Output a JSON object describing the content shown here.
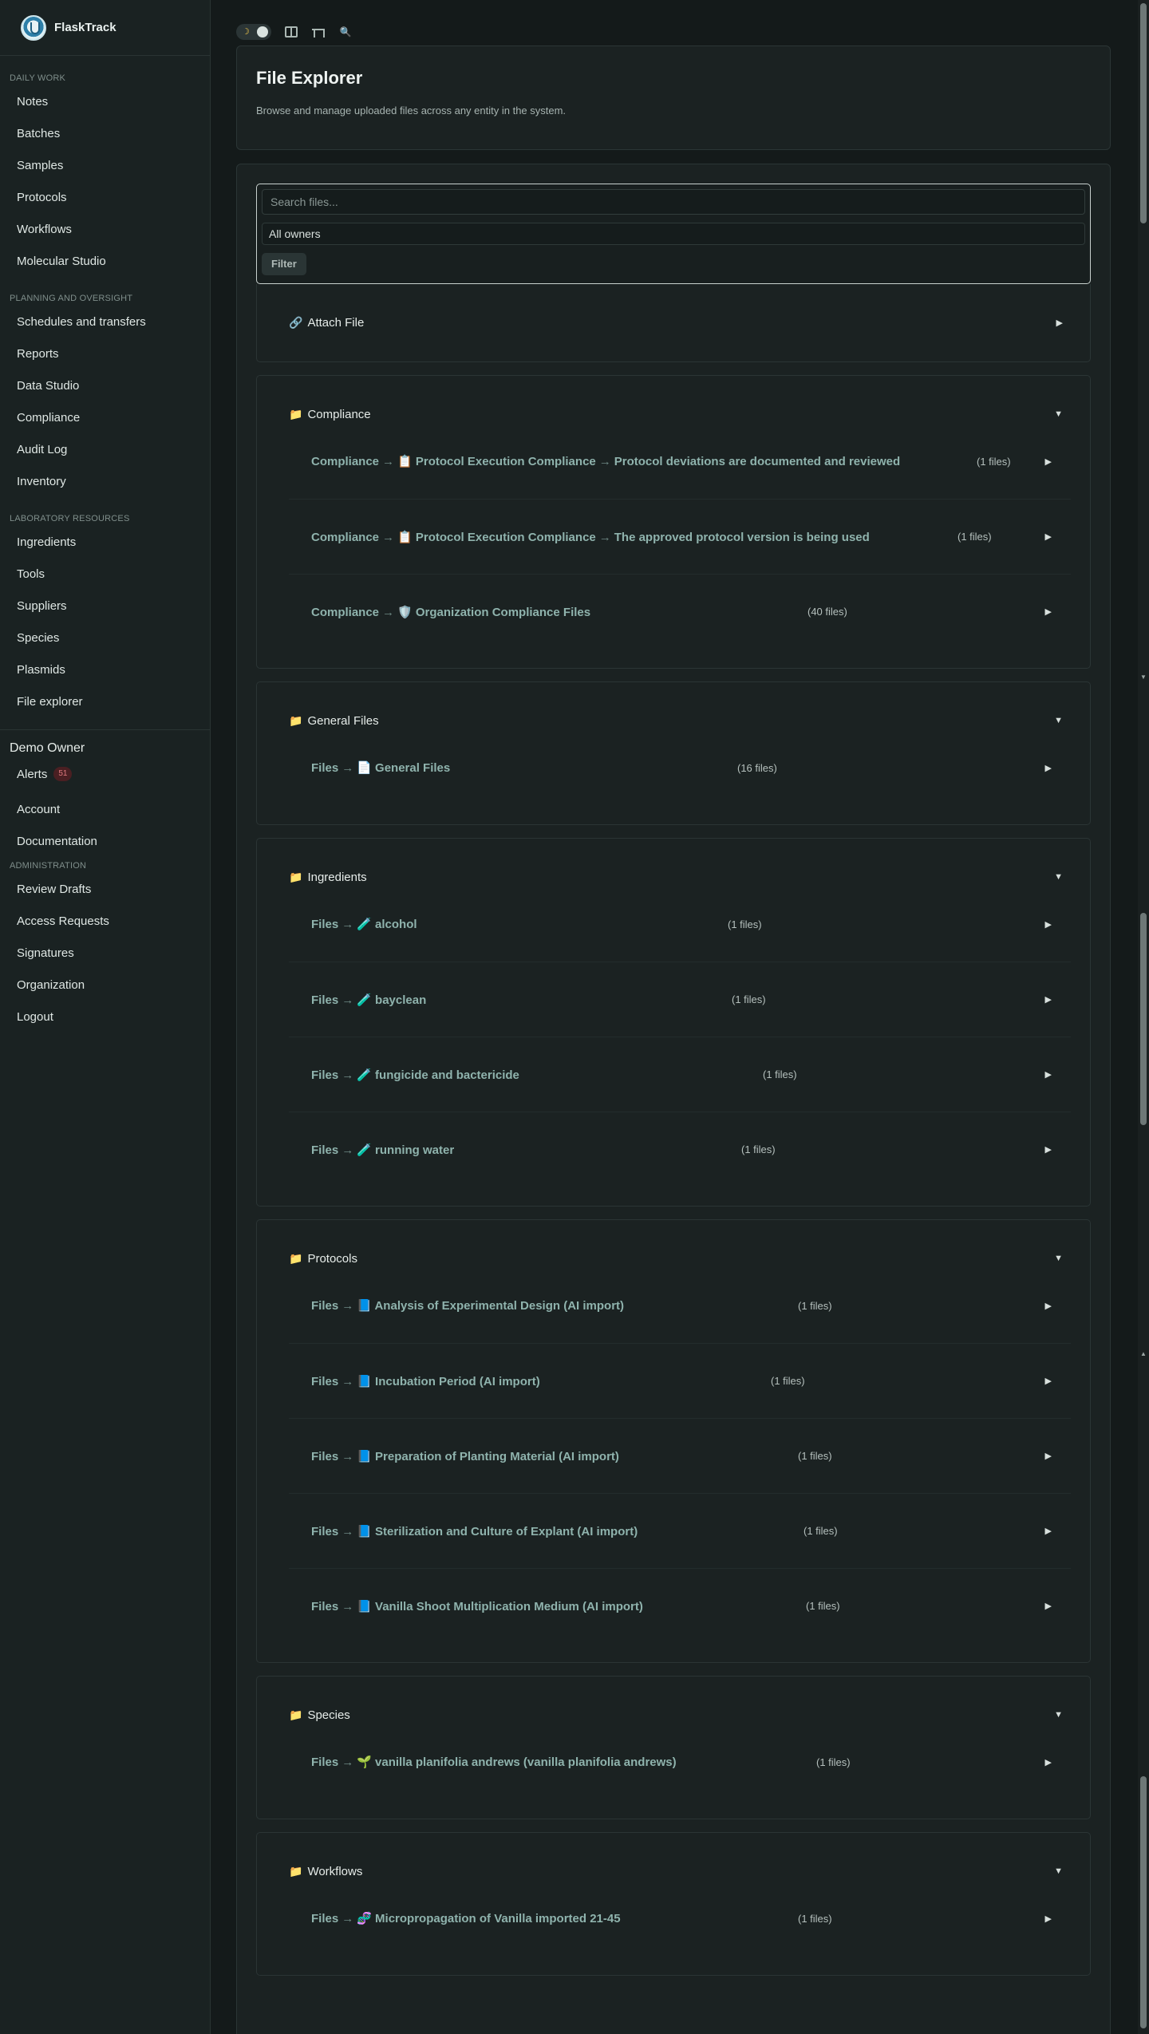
{
  "app": {
    "name": "FlaskTrack"
  },
  "sidebar": {
    "daily_work": {
      "heading": "DAILY WORK",
      "items": [
        "Notes",
        "Batches",
        "Samples",
        "Protocols",
        "Workflows",
        "Molecular Studio"
      ]
    },
    "planning": {
      "heading": "PLANNING AND OVERSIGHT",
      "items": [
        "Schedules and transfers",
        "Reports",
        "Data Studio",
        "Compliance",
        "Audit Log",
        "Inventory"
      ]
    },
    "lab_resources": {
      "heading": "LABORATORY RESOURCES",
      "items": [
        "Ingredients",
        "Tools",
        "Suppliers",
        "Species",
        "Plasmids",
        "File explorer"
      ]
    },
    "owner": {
      "name": "Demo Owner",
      "alerts_label": "Alerts",
      "alerts_badge": "51",
      "account": "Account",
      "documentation": "Documentation"
    },
    "administration": {
      "heading": "ADMINISTRATION",
      "items": [
        "Review Drafts",
        "Access Requests",
        "Signatures",
        "Organization",
        "Logout"
      ]
    }
  },
  "toolbar": {
    "theme_icon": "moon-icon"
  },
  "header": {
    "title": "File Explorer",
    "subtitle": "Browse and manage uploaded files across any entity in the system."
  },
  "filters": {
    "search_placeholder": "Search files...",
    "owner_value": "All owners",
    "filter_label": "Filter"
  },
  "attach": {
    "label": "Attach File"
  },
  "sections": {
    "compliance": {
      "title": "Compliance",
      "entries": [
        {
          "path": [
            "Compliance",
            "📋 Protocol Execution Compliance",
            "Protocol deviations are documented and reviewed"
          ],
          "count": "(1 files)"
        },
        {
          "path": [
            "Compliance",
            "📋 Protocol Execution Compliance",
            "The approved protocol version is being used"
          ],
          "count": "(1 files)"
        },
        {
          "path": [
            "Compliance",
            "🛡️ Organization Compliance Files"
          ],
          "count": "(40 files)"
        }
      ]
    },
    "general": {
      "title": "General Files",
      "entries": [
        {
          "path": [
            "Files",
            "📄 General Files"
          ],
          "count": "(16 files)"
        }
      ]
    },
    "ingredients": {
      "title": "Ingredients",
      "entries": [
        {
          "path": [
            "Files",
            "🧪 alcohol"
          ],
          "count": "(1 files)"
        },
        {
          "path": [
            "Files",
            "🧪 bayclean"
          ],
          "count": "(1 files)"
        },
        {
          "path": [
            "Files",
            "🧪 fungicide and bactericide"
          ],
          "count": "(1 files)"
        },
        {
          "path": [
            "Files",
            "🧪 running water"
          ],
          "count": "(1 files)"
        }
      ]
    },
    "protocols": {
      "title": "Protocols",
      "entries": [
        {
          "path": [
            "Files",
            "📘 Analysis of Experimental Design (AI import)"
          ],
          "count": "(1 files)"
        },
        {
          "path": [
            "Files",
            "📘 Incubation Period (AI import)"
          ],
          "count": "(1 files)"
        },
        {
          "path": [
            "Files",
            "📘 Preparation of Planting Material (AI import)"
          ],
          "count": "(1 files)"
        },
        {
          "path": [
            "Files",
            "📘 Sterilization and Culture of Explant (AI import)"
          ],
          "count": "(1 files)"
        },
        {
          "path": [
            "Files",
            "📘 Vanilla Shoot Multiplication Medium (AI import)"
          ],
          "count": "(1 files)"
        }
      ]
    },
    "species": {
      "title": "Species",
      "entries": [
        {
          "path": [
            "Files",
            "🌱 vanilla planifolia andrews (vanilla planifolia andrews)"
          ],
          "count": "(1 files)"
        }
      ]
    },
    "workflows": {
      "title": "Workflows",
      "entries": [
        {
          "path": [
            "Files",
            "🧬 Micropropagation of Vanilla imported 21-45"
          ],
          "count": "(1 files)"
        }
      ]
    }
  },
  "symbols": {
    "arrow": "→",
    "expanded": "▼",
    "collapsed": "▶",
    "folder": "📁",
    "link": "🔗"
  }
}
